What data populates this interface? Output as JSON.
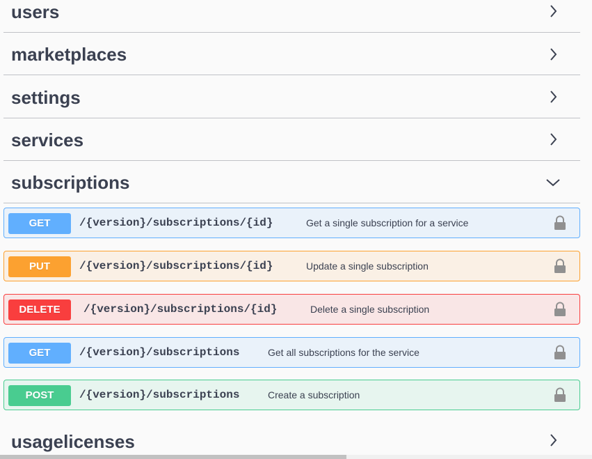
{
  "tags": [
    {
      "name": "users",
      "expanded": false
    },
    {
      "name": "marketplaces",
      "expanded": false
    },
    {
      "name": "settings",
      "expanded": false
    },
    {
      "name": "services",
      "expanded": false
    },
    {
      "name": "subscriptions",
      "expanded": true
    },
    {
      "name": "usagelicenses",
      "expanded": false
    }
  ],
  "operations": [
    {
      "method": "GET",
      "path": "/{version}/subscriptions/{id}",
      "summary": "Get a single subscription for a service",
      "locked": true
    },
    {
      "method": "PUT",
      "path": "/{version}/subscriptions/{id}",
      "summary": "Update a single subscription",
      "locked": true
    },
    {
      "method": "DELETE",
      "path": "/{version}/subscriptions/{id}",
      "summary": "Delete a single subscription",
      "locked": true
    },
    {
      "method": "GET",
      "path": "/{version}/subscriptions",
      "summary": "Get all subscriptions for the service",
      "locked": true
    },
    {
      "method": "POST",
      "path": "/{version}/subscriptions",
      "summary": "Create a subscription",
      "locked": true
    }
  ],
  "colors": {
    "get": "#61affe",
    "put": "#fca130",
    "delete": "#f93e3e",
    "post": "#49cc90",
    "text": "#3b4151"
  },
  "icons": {
    "collapsed": "chevron-right-icon",
    "expanded": "chevron-down-icon",
    "auth": "lock-icon"
  }
}
